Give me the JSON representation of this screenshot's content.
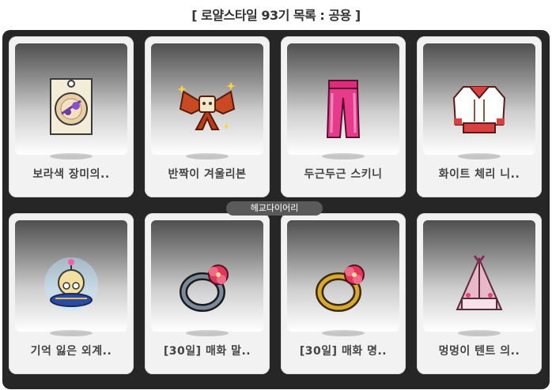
{
  "page": {
    "title": "[ 로얄스타일 93기 목록 : 공용 ]"
  },
  "items": [
    {
      "name": "보라색 장미의..",
      "icon": "purple-rose-badge-icon"
    },
    {
      "name": "반짝이 겨울리본",
      "icon": "sparkle-ribbon-icon"
    },
    {
      "name": "두근두근 스키니",
      "icon": "pink-skinny-pants-icon"
    },
    {
      "name": "화이트 체리 니..",
      "icon": "white-cherry-knit-icon"
    },
    {
      "name": "기억 잃은 외계..",
      "icon": "ufo-alien-icon"
    },
    {
      "name": "[30일] 매화 말..",
      "icon": "plum-blossom-ring-silver-icon"
    },
    {
      "name": "[30일] 매화 명..",
      "icon": "plum-blossom-ring-gold-icon"
    },
    {
      "name": "멍멍이 텐트 의..",
      "icon": "puppy-tent-chair-icon"
    }
  ],
  "watermark": "헤교다이어리"
}
